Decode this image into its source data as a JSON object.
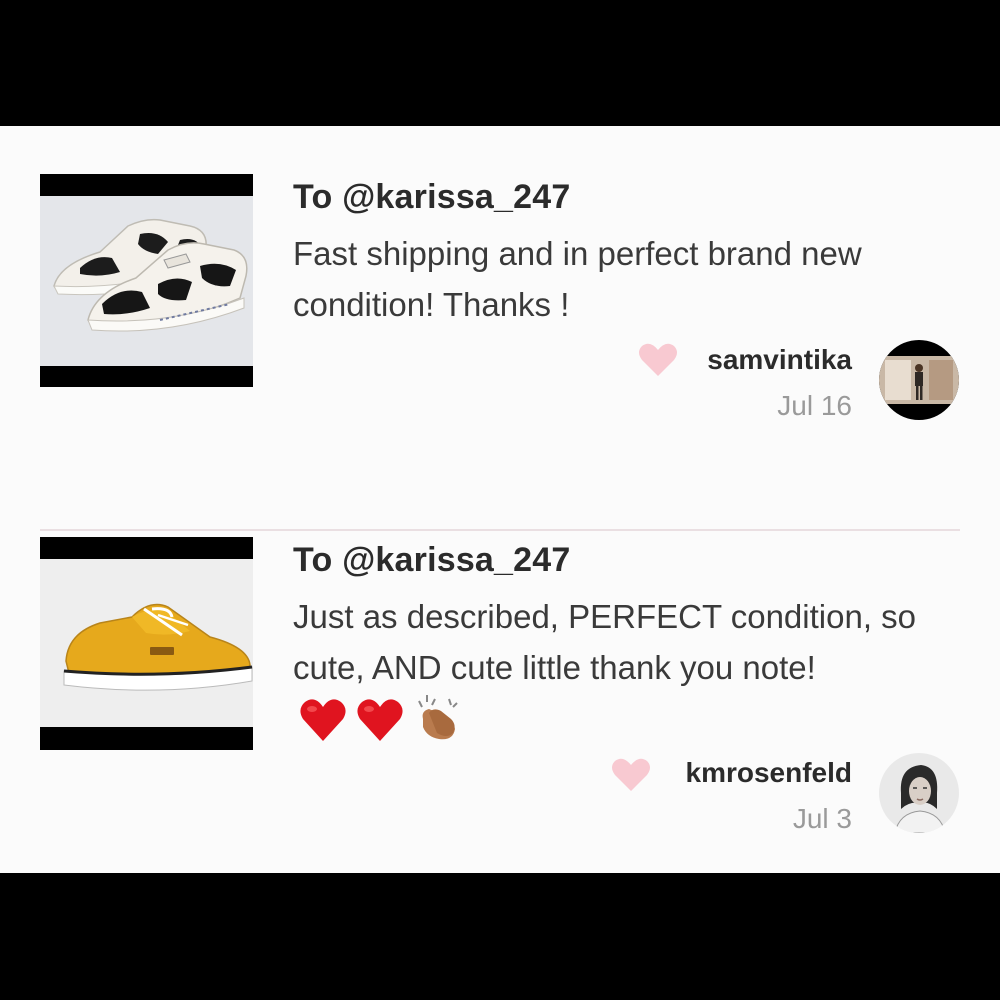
{
  "reviews": [
    {
      "to_prefix": "To ",
      "recipient": "@karissa_247",
      "text": "Fast shipping and in perfect brand new condition! Thanks !",
      "reviewer": "samvintika",
      "date": "Jul 16",
      "product_image": "cow-print-sneakers",
      "emojis": []
    },
    {
      "to_prefix": "To ",
      "recipient": "@karissa_247",
      "text": "Just as described, PERFECT condition, so cute, AND cute little thank you note!",
      "reviewer": "kmrosenfeld",
      "date": "Jul 3",
      "product_image": "yellow-sneaker",
      "emojis": [
        "red-heart-icon",
        "red-heart-icon",
        "clapping-hands-icon"
      ]
    }
  ],
  "colors": {
    "heart": "#f8c9d1",
    "emoji_heart": "#e0141f",
    "yellow_shoe": "#e6a91c",
    "background": "#fbfbfb"
  }
}
